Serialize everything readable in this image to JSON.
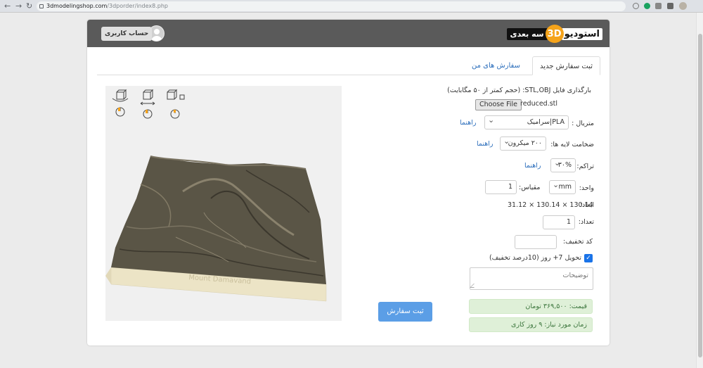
{
  "browser": {
    "url_host": "3dmodelingshop.com",
    "url_path": "/3dporder/index8.php",
    "back": "←",
    "forward": "→",
    "reload": "↻"
  },
  "header": {
    "logo_word1": "استودیو",
    "logo_badge": "3D",
    "logo_word2": "سه بعدی",
    "user_button": "حساب کاربری"
  },
  "tabs": [
    {
      "label": "ثبت سفارش جدید",
      "active": true
    },
    {
      "label": "سفارش های من",
      "active": false
    }
  ],
  "form": {
    "upload_label": "بارگذاری فایل STL,OBJ: (حجم کمتر از ۵۰ مگابایت)",
    "choose_file": "Choose File",
    "file_name": "reduced.stl",
    "material_label": "متریال :",
    "material_value": "PLA|سرامیک",
    "layer_label": "ضخامت لایه ها:",
    "layer_value": "۲۰۰ میکرون",
    "density_label": "تراکم:",
    "density_value": "۳۰%",
    "guide_link": "راهنما",
    "unit_label": "واحد:",
    "unit_value": "mm",
    "scale_label": "مقیاس:",
    "scale_value": "1",
    "dims_label": "ابعاد:",
    "dims_value": "31.12 × 130.14 × 130.14",
    "count_label": "تعداد:",
    "count_value": "1",
    "discount_label": "کد تخفیف:",
    "discount_value": "",
    "delivery_label": "تحویل 7+ روز (10درصد تخفیف)",
    "delivery_checked": true,
    "notes_placeholder": "توضیحات",
    "price_text": "قیمت: ۳۶۹,۵۰۰ تومان",
    "time_text": "زمان مورد نیاز: ۹ روز کاری",
    "submit_label": "ثبت سفارش"
  },
  "viewer": {
    "model_text": "Mount Damavand"
  },
  "colors": {
    "header_bg": "#5a5a5a",
    "logo_badge": "#f5a31a",
    "link": "#2a6dbb",
    "submit_bg": "#5b9ee6",
    "alert_bg": "#dff0d8",
    "terrain": "#5a5546",
    "base": "#ece4c6"
  }
}
